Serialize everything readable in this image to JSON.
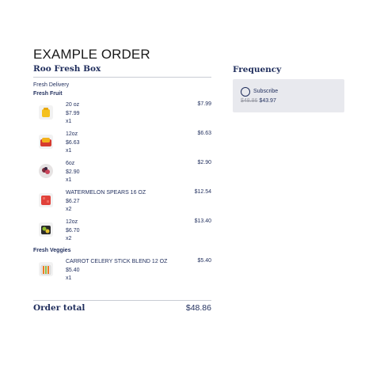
{
  "page_title": "EXAMPLE ORDER",
  "box_title": "Roo Fresh Box",
  "delivery_label": "Fresh Delivery",
  "categories": [
    {
      "name": "Fresh Fruit",
      "items": [
        {
          "name": "20 oz",
          "unit_price": "$7.99",
          "qty": "x1",
          "total": "$7.99",
          "icon": "pineapple-chunks-icon"
        },
        {
          "name": "12oz",
          "unit_price": "$6.63",
          "qty": "x1",
          "total": "$6.63",
          "icon": "mango-spears-icon"
        },
        {
          "name": "6oz",
          "unit_price": "$2.90",
          "qty": "x1",
          "total": "$2.90",
          "icon": "berry-mix-icon"
        },
        {
          "name": "WATERMELON SPEARS 16 OZ",
          "unit_price": "$6.27",
          "qty": "x2",
          "total": "$12.54",
          "icon": "watermelon-spears-icon"
        },
        {
          "name": "12oz",
          "unit_price": "$6.70",
          "qty": "x2",
          "total": "$13.40",
          "icon": "kiwi-cup-icon"
        }
      ]
    },
    {
      "name": "Fresh Veggies",
      "items": [
        {
          "name": "CARROT CELERY STICK BLEND 12 OZ",
          "unit_price": "$5.40",
          "qty": "x1",
          "total": "$5.40",
          "icon": "carrot-celery-icon"
        }
      ]
    }
  ],
  "order_total_label": "Order total",
  "order_total_value": "$48.86",
  "frequency": {
    "title": "Frequency",
    "option_label": "Subscribe",
    "old_price": "$48.86",
    "new_price": "$43.97"
  }
}
